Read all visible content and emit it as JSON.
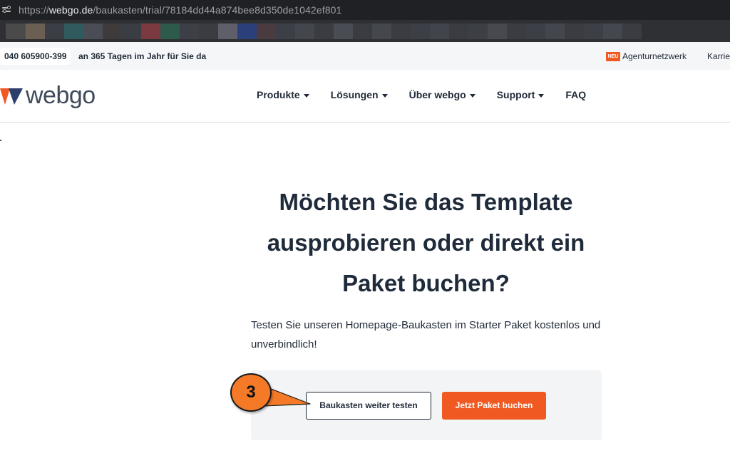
{
  "browser": {
    "url_prefix": "https://",
    "url_domain": "webgo.de",
    "url_path": "/baukasten/trial/78184dd44a874bee8d350de1042ef801",
    "bookmark_colors": [
      "#4a4a4a",
      "#6b5f54",
      "#3b3f45",
      "#2f5a5e",
      "#4a4d55",
      "#3f3a3c",
      "#3b3d44",
      "#7a3a3f",
      "#2d5a4a",
      "#3d3f46",
      "#3a3c42",
      "#5f5f6a",
      "#2b3f7a",
      "#4a3b40",
      "#3d3f46",
      "#44464d",
      "#3a3c42",
      "#4a4c54",
      "#3a3c42",
      "#45474e",
      "#3a3c42",
      "#3d3f46",
      "#42444b",
      "#3a3c42",
      "#3d3f46",
      "#48494f",
      "#3a3c42",
      "#3d3f46",
      "#44464d",
      "#3a3c42",
      "#3d3f46",
      "#45474e",
      "#3a3c42"
    ]
  },
  "infobar": {
    "phone": "040 605900-399",
    "tagline": "an 365 Tagen im Jahr für Sie da",
    "new_badge": "NEU",
    "agentur_link": "Agenturnetzwerk",
    "karriere_link": "Karrie"
  },
  "header": {
    "logo_text": "webgo",
    "brand_colors": {
      "orange": "#f05a22",
      "navy": "#2c3e6b"
    },
    "nav": [
      {
        "label": "Produkte",
        "dropdown": true
      },
      {
        "label": "Lösungen",
        "dropdown": true
      },
      {
        "label": "Über webgo",
        "dropdown": true
      },
      {
        "label": "Support",
        "dropdown": true
      },
      {
        "label": "FAQ",
        "dropdown": false
      }
    ]
  },
  "main": {
    "title_lines": [
      "Möchten Sie das Template",
      "ausprobieren oder direkt ein",
      "Paket buchen?"
    ],
    "subtitle": "Testen Sie unseren Homepage-Baukasten im Starter Paket kostenlos und unverbindlich!",
    "secondary_button": "Baukasten weiter testen",
    "primary_button": "Jetzt Paket buchen"
  },
  "annotation": {
    "step_number": "3",
    "color": "#f47a28"
  }
}
